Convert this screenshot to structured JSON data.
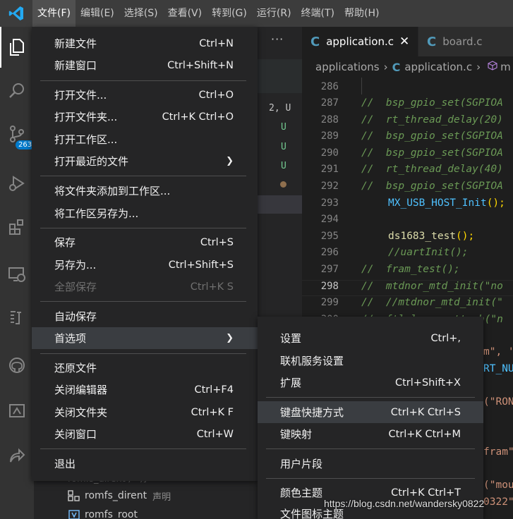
{
  "menubar": {
    "items": [
      "文件(F)",
      "编辑(E)",
      "选择(S)",
      "查看(V)",
      "转到(G)",
      "运行(R)",
      "终端(T)",
      "帮助(H)"
    ]
  },
  "activity": {
    "scm_badge": "263"
  },
  "sidebar": {
    "more": "···",
    "scm_marks": [
      "2, U",
      "U",
      "U",
      "U"
    ],
    "tree": [
      {
        "label": "romfs_dirent",
        "desc": "声明"
      },
      {
        "label": "romfs_root",
        "desc": ""
      }
    ]
  },
  "tabs": [
    {
      "label": "application.c",
      "close": "✕"
    },
    {
      "label": "board.c"
    }
  ],
  "breadcrumb": {
    "folder": "applications",
    "file": "application.c",
    "symbol": "m"
  },
  "editor": {
    "lines": [
      {
        "num": "286"
      },
      {
        "num": "287"
      },
      {
        "num": "288"
      },
      {
        "num": "289"
      },
      {
        "num": "290"
      },
      {
        "num": "291"
      },
      {
        "num": "292"
      },
      {
        "num": "293"
      },
      {
        "num": "294"
      },
      {
        "num": "295"
      },
      {
        "num": "296"
      },
      {
        "num": "297"
      },
      {
        "num": "298"
      },
      {
        "num": "299"
      },
      {
        "num": "300"
      }
    ],
    "code": {
      "l287_a": "//  ",
      "l287_fn": "bsp_gpio_set",
      "l287_b": "(SGPIOA",
      "l288_a": "//  ",
      "l288_fn": "rt_thread_delay",
      "l288_b": "(20)",
      "l289_a": "//  ",
      "l289_fn": "bsp_gpio_set",
      "l289_b": "(SGPIOA",
      "l290_a": "//  ",
      "l290_fn": "bsp_gpio_set",
      "l290_b": "(SGPIOA",
      "l291_a": "//  ",
      "l291_fn": "rt_thread_delay",
      "l291_b": "(40)",
      "l292_a": "//  ",
      "l292_fn": "bsp_gpio_set",
      "l292_b": "(SGPIOA",
      "l293_fn": "MX_USB_HOST_Init",
      "l293_b": "();",
      "l295_fn": "ds1683_test",
      "l295_b": "();",
      "l296_a": "//",
      "l296_fn": "uartInit",
      "l296_b": "();",
      "l297_a": "//  ",
      "l297_fn": "fram_test",
      "l297_b": "();",
      "l298_a": "//  ",
      "l298_fn": "mtdnor_mtd_init",
      "l298_b": "(\"no",
      "l299_a": "//  //",
      "l299_fn": "mtdnor_mtd_init",
      "l299_b": "(\"",
      "l300_a": "//  ",
      "l300_fn": "ftl_layer_attach",
      "l300_b": "(\"n",
      "r1": "m\", '",
      "r2": "RT_NU",
      "r3": "(\"RON",
      "r4": "fram\"",
      "r5": "(\"mou",
      "r6": "0322\","
    }
  },
  "file_menu": {
    "items": [
      {
        "label": "新建文件",
        "kb": "Ctrl+N"
      },
      {
        "label": "新建窗口",
        "kb": "Ctrl+Shift+N"
      },
      {
        "label": "打开文件...",
        "kb": "Ctrl+O"
      },
      {
        "label": "打开文件夹...",
        "kb": "Ctrl+K Ctrl+O"
      },
      {
        "label": "打开工作区...",
        "kb": ""
      },
      {
        "label": "打开最近的文件",
        "kb": ""
      },
      {
        "label": "将文件夹添加到工作区...",
        "kb": ""
      },
      {
        "label": "将工作区另存为...",
        "kb": ""
      },
      {
        "label": "保存",
        "kb": "Ctrl+S"
      },
      {
        "label": "另存为...",
        "kb": "Ctrl+Shift+S"
      },
      {
        "label": "全部保存",
        "kb": "Ctrl+K S"
      },
      {
        "label": "自动保存",
        "kb": ""
      },
      {
        "label": "首选项",
        "kb": ""
      },
      {
        "label": "还原文件",
        "kb": ""
      },
      {
        "label": "关闭编辑器",
        "kb": "Ctrl+F4"
      },
      {
        "label": "关闭文件夹",
        "kb": "Ctrl+K F"
      },
      {
        "label": "关闭窗口",
        "kb": "Ctrl+W"
      },
      {
        "label": "退出",
        "kb": ""
      }
    ]
  },
  "pref_menu": {
    "items": [
      {
        "label": "设置",
        "kb": "Ctrl+,"
      },
      {
        "label": "联机服务设置",
        "kb": ""
      },
      {
        "label": "扩展",
        "kb": "Ctrl+Shift+X"
      },
      {
        "label": "键盘快捷方式",
        "kb": "Ctrl+K Ctrl+S"
      },
      {
        "label": "键映射",
        "kb": "Ctrl+K Ctrl+M"
      },
      {
        "label": "用户片段",
        "kb": ""
      },
      {
        "label": "颜色主题",
        "kb": "Ctrl+K Ctrl+T"
      },
      {
        "label": "文件图标主题",
        "kb": ""
      }
    ]
  },
  "watermark": "https://blog.csdn.net/wandersky0822"
}
